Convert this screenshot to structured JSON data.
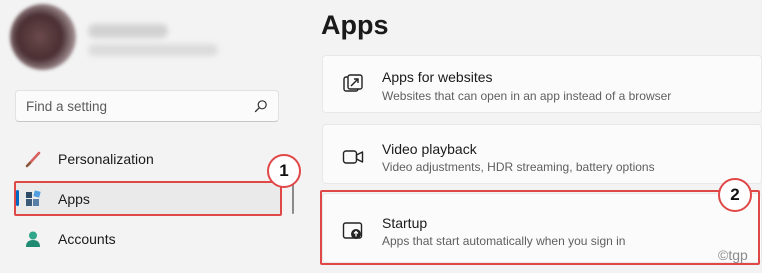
{
  "search": {
    "placeholder": "Find a setting"
  },
  "nav": {
    "personalization": "Personalization",
    "apps": "Apps",
    "accounts": "Accounts"
  },
  "main": {
    "title": "Apps",
    "cards": [
      {
        "title": "Apps for websites",
        "subtitle": "Websites that can open in an app instead of a browser",
        "icon": "link-window-icon"
      },
      {
        "title": "Video playback",
        "subtitle": "Video adjustments, HDR streaming, battery options",
        "icon": "video-camera-icon"
      },
      {
        "title": "Startup",
        "subtitle": "Apps that start automatically when you sign in",
        "icon": "startup-icon"
      }
    ]
  },
  "annotations": {
    "callout_1": "1",
    "callout_2": "2",
    "highlight_color": "#e04848"
  },
  "watermark": "©tgp",
  "colors": {
    "accent": "#0067c0",
    "background": "#f3f3f3",
    "card": "#fbfbfb"
  }
}
